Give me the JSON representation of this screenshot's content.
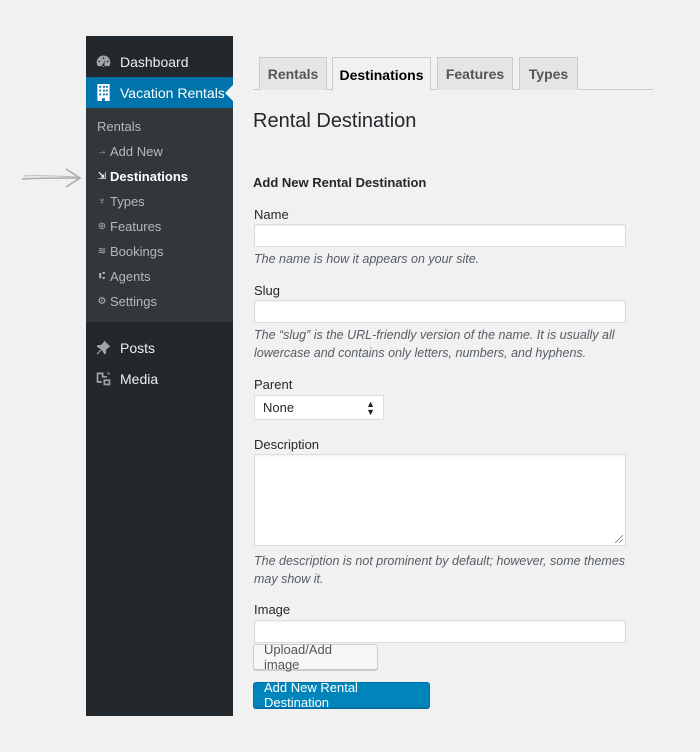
{
  "sidebar": {
    "dashboard": {
      "label": "Dashboard",
      "icon": "dashboard-icon"
    },
    "vacation_rentals": {
      "label": "Vacation Rentals",
      "icon": "building-icon"
    },
    "submenu": [
      {
        "label": "Rentals",
        "icon": ""
      },
      {
        "label": "Add New",
        "icon": "arrow-right-icon",
        "glyph": "→"
      },
      {
        "label": "Destinations",
        "icon": "destination-icon",
        "glyph": "⇲"
      },
      {
        "label": "Types",
        "icon": "types-icon",
        "glyph": "♆"
      },
      {
        "label": "Features",
        "icon": "features-icon",
        "glyph": "⊛"
      },
      {
        "label": "Bookings",
        "icon": "bookings-icon",
        "glyph": "≋"
      },
      {
        "label": "Agents",
        "icon": "agents-icon",
        "glyph": "⑆"
      },
      {
        "label": "Settings",
        "icon": "settings-icon",
        "glyph": "⚙"
      }
    ],
    "posts": {
      "label": "Posts",
      "icon": "pin-icon"
    },
    "media": {
      "label": "Media",
      "icon": "media-icon"
    }
  },
  "tabs": [
    {
      "label": "Rentals"
    },
    {
      "label": "Destinations"
    },
    {
      "label": "Features"
    },
    {
      "label": "Types"
    }
  ],
  "page_title": "Rental Destination",
  "form": {
    "section_title": "Add New Rental Destination",
    "name": {
      "label": "Name",
      "value": "",
      "help": "The name is how it appears on your site."
    },
    "slug": {
      "label": "Slug",
      "value": "",
      "help_line1": "The “slug” is the URL-friendly version of the name. It is usually all",
      "help_line2": "lowercase and contains only letters, numbers, and hyphens."
    },
    "parent": {
      "label": "Parent",
      "selected": "None"
    },
    "description": {
      "label": "Description",
      "help_line1": "The description is not prominent by default; however, some themes",
      "help_line2": "may show it."
    },
    "image": {
      "label": "Image",
      "value": "",
      "upload_button": "Upload/Add image"
    },
    "submit_button": "Add New Rental Destination"
  },
  "colors": {
    "sidebar_bg": "#23282d",
    "submenu_bg": "#32373c",
    "accent": "#0073aa",
    "primary_button": "#0085ba"
  }
}
